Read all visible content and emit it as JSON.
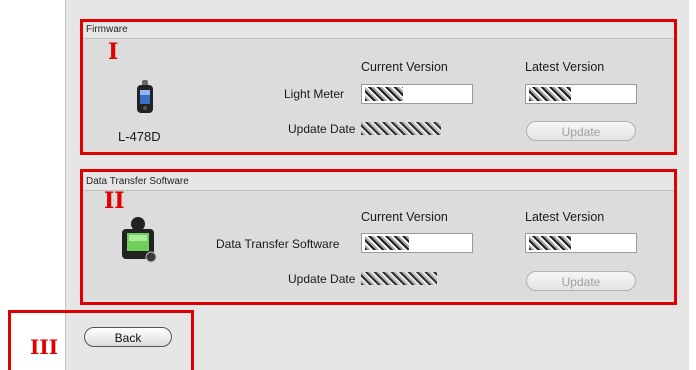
{
  "firmware": {
    "group_title": "Firmware",
    "marker": "I",
    "device_name": "L-478D",
    "current_version_header": "Current Version",
    "latest_version_header": "Latest Version",
    "row_label": "Light Meter",
    "update_date_label": "Update Date",
    "update_button": "Update"
  },
  "data_transfer": {
    "group_title": "Data Transfer Software",
    "marker": "II",
    "current_version_header": "Current Version",
    "latest_version_header": "Latest Version",
    "row_label": "Data Transfer Software",
    "update_date_label": "Update Date",
    "update_button": "Update"
  },
  "footer": {
    "marker": "III",
    "back_button": "Back"
  },
  "colors": {
    "annotation": "#e00000",
    "panel": "#e6e6e6"
  },
  "icons": {
    "firmware": "light-meter-device-icon",
    "data_transfer": "data-transfer-software-icon"
  }
}
